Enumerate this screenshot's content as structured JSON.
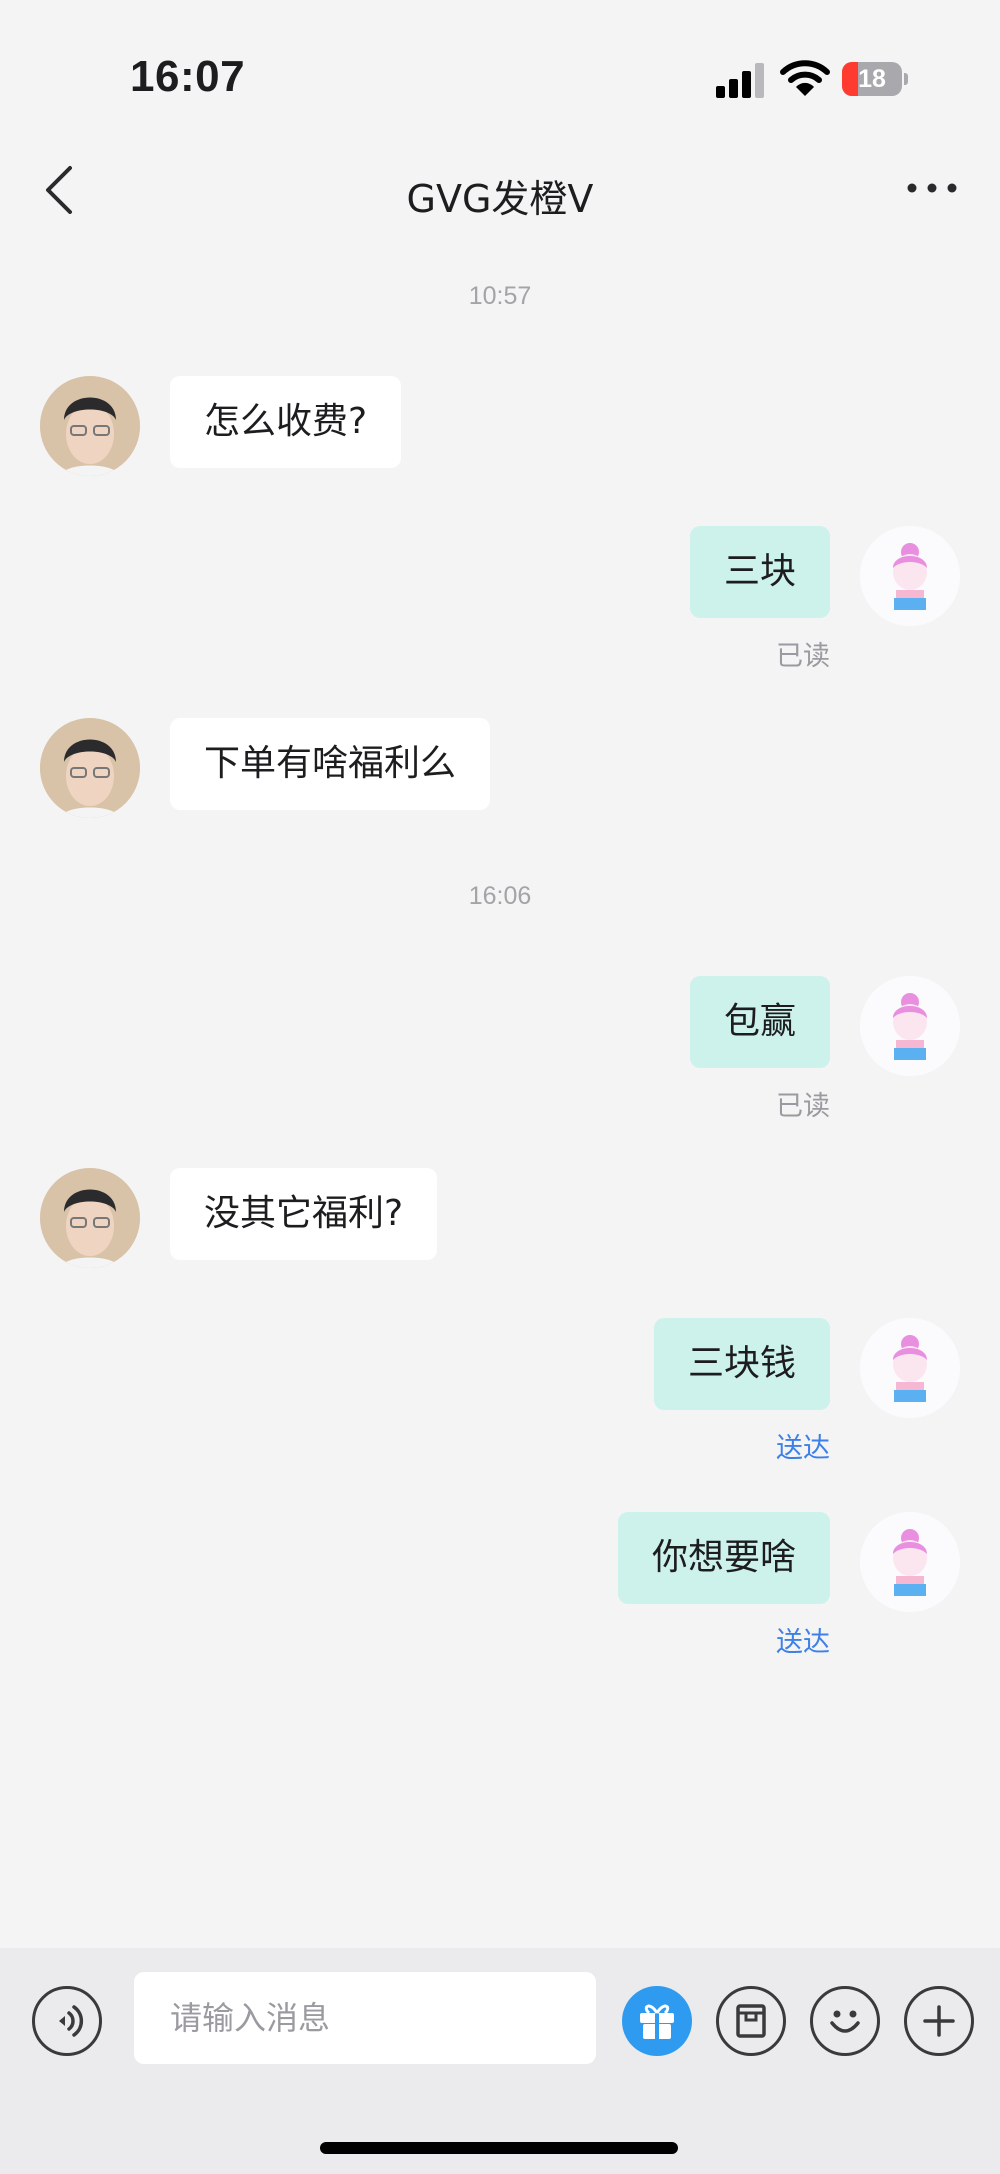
{
  "status_bar": {
    "time": "16:07",
    "battery": "18"
  },
  "header": {
    "title": "GVG发橙V"
  },
  "timestamps": [
    "10:57",
    "16:06"
  ],
  "messages": [
    {
      "side": "in",
      "text": "怎么收费?"
    },
    {
      "side": "out",
      "text": "三块",
      "receipt": "已读"
    },
    {
      "side": "in",
      "text": "下单有啥福利么"
    },
    {
      "side": "out",
      "text": "包赢",
      "receipt": "已读"
    },
    {
      "side": "in",
      "text": "没其它福利?"
    },
    {
      "side": "out",
      "text": "三块钱",
      "receipt": "送达"
    },
    {
      "side": "out",
      "text": "你想要啥",
      "receipt": "送达"
    }
  ],
  "input": {
    "placeholder": "请输入消息"
  },
  "icons": {
    "back": "chevron-left-icon",
    "more": "more-horizontal-icon",
    "voice": "voice-icon",
    "gift": "gift-icon",
    "order": "order-icon",
    "emoji": "emoji-icon",
    "plus": "plus-icon"
  },
  "colors": {
    "background": "#f4f4f5",
    "incoming_bubble": "#ffffff",
    "outgoing_bubble": "#cdf2ec",
    "sent_receipt": "#3f80e6",
    "gift_button": "#2f9bf0"
  }
}
